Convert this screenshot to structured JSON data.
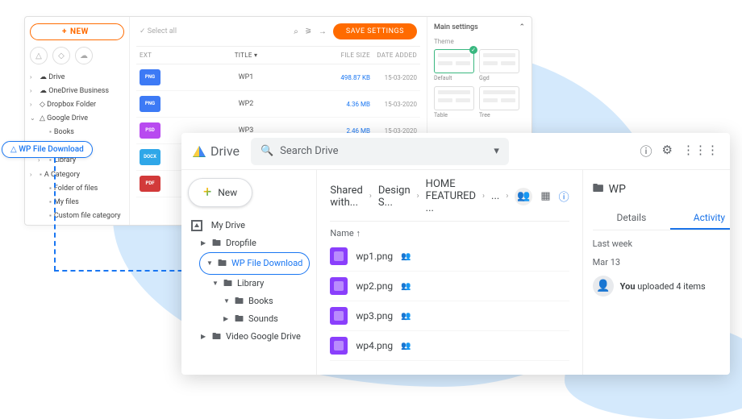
{
  "panel1": {
    "newButton": "NEW",
    "selectAll": "Select all",
    "saveSettings": "SAVE SETTINGS",
    "tree": {
      "drive": "Drive",
      "onedrive": "OneDrive Business",
      "dropbox": "Dropbox Folder",
      "google": "Google Drive",
      "books": "Books",
      "wpfile": "WP File Download",
      "library": "Library",
      "acategory": "A Category",
      "folderoffiles": "Folder of files",
      "myfiles": "My files",
      "custom": "Custom file category"
    },
    "headers": {
      "ext": "EXT",
      "title": "TITLE",
      "size": "FILE SIZE",
      "date": "DATE ADDED"
    },
    "files": [
      {
        "ext": "PNG",
        "color": "#3d7af5",
        "title": "WP1",
        "size": "498.87 KB",
        "date": "15-03-2020"
      },
      {
        "ext": "PNG",
        "color": "#3d7af5",
        "title": "WP2",
        "size": "4.36 MB",
        "date": "15-03-2020"
      },
      {
        "ext": "PSD",
        "color": "#b84af0",
        "title": "WP3",
        "size": "2.46 MB",
        "date": "15-03-2020"
      },
      {
        "ext": "DOCX",
        "color": "#2fa7e8",
        "title": "",
        "size": "",
        "date": ""
      },
      {
        "ext": "PDF",
        "color": "#d23a3a",
        "title": "",
        "size": "",
        "date": ""
      }
    ],
    "settings": {
      "main": "Main settings",
      "themeLabel": "Theme",
      "themes": [
        {
          "name": "Default",
          "active": true
        },
        {
          "name": "Ggd",
          "active": false
        },
        {
          "name": "Table",
          "active": false
        },
        {
          "name": "Tree",
          "active": false
        }
      ]
    }
  },
  "panel2": {
    "brand": "Drive",
    "searchPlaceholder": "Search Drive",
    "newButton": "New",
    "side": {
      "mydrive": "My Drive",
      "dropfile": "Dropfile",
      "wpfile": "WP File Download",
      "library": "Library",
      "books": "Books",
      "sounds": "Sounds",
      "video": "Video Google Drive"
    },
    "crumb": [
      "Shared with...",
      "Design S...",
      "HOME FEATURED ...",
      "..."
    ],
    "listHeader": "Name",
    "sortArrow": "↑",
    "files": [
      {
        "name": "wp1.png"
      },
      {
        "name": "wp2.png"
      },
      {
        "name": "wp3.png"
      },
      {
        "name": "wp4.png"
      }
    ],
    "info": {
      "title": "WP",
      "tabs": {
        "details": "Details",
        "activity": "Activity"
      },
      "section": "Last week",
      "date": "Mar 13",
      "activityText": "You uploaded 4 items",
      "you": "You"
    }
  }
}
